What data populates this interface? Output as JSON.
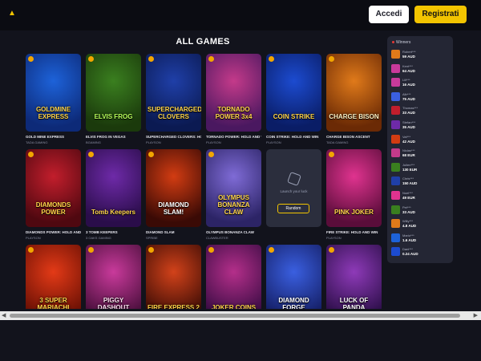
{
  "header": {
    "login_label": "Accedi",
    "register_label": "Registrati",
    "logo_glyph": "▲"
  },
  "section_title": "ALL GAMES",
  "games": [
    {
      "name": "GOLD MINE EXPRESS",
      "provider": "TADA GAMING",
      "logo": "GOLDMINE EXPRESS",
      "c1": "#1d62d9",
      "c2": "#0d2a78",
      "tc": "#ffd54a"
    },
    {
      "name": "ELVIS FROG IN VEGAS",
      "provider": "BGAMING",
      "logo": "ELVIS FROG",
      "c1": "#3a7f1f",
      "c2": "#1b3a0c",
      "tc": "#b7ff5a"
    },
    {
      "name": "SUPERCHARGED CLOVERS: HOLD AND WIN",
      "provider": "PLAYSON",
      "logo": "SUPERCHARGED CLOVERS",
      "c1": "#1f3fa8",
      "c2": "#0b1a52",
      "tc": "#ffd54a"
    },
    {
      "name": "TORNADO POWER: HOLD AND WIN",
      "provider": "PLAYSON",
      "logo": "TORNADO POWER 3x4",
      "c1": "#c43a8a",
      "c2": "#4a1860",
      "tc": "#ffd54a"
    },
    {
      "name": "COIN STRIKE: HOLD AND WIN",
      "provider": "PLAYSON",
      "logo": "COIN STRIKE",
      "c1": "#1c4bd0",
      "c2": "#0a1d66",
      "tc": "#ffd54a"
    },
    {
      "name": "CHARGE BISON ASCENT",
      "provider": "TADA GAMING",
      "logo": "CHARGE BISON",
      "c1": "#e07a1a",
      "c2": "#6b2a05",
      "tc": "#fff1c2"
    },
    {
      "name": "DIAMONDS POWER: HOLD AND WIN",
      "provider": "PLAYSON",
      "logo": "DIAMONDS POWER",
      "c1": "#c21e2c",
      "c2": "#4f0810",
      "tc": "#ffd54a"
    },
    {
      "name": "3 TOMB KEEPERS",
      "provider": "3 OAKS GAMING",
      "logo": "Tomb Keepers",
      "c1": "#6e2aa8",
      "c2": "#2a0d4a",
      "tc": "#ffd54a"
    },
    {
      "name": "DIAMOND SLAM",
      "provider": "SPRIBE",
      "logo": "DIAMOND SLAM!",
      "c1": "#d23c12",
      "c2": "#3a0a05",
      "tc": "#ffffff"
    },
    {
      "name": "OLYMPUS BONANZA CLAW",
      "provider": "CLAWBUSTER",
      "logo": "OLYMPUS BONANZA CLAW",
      "c1": "#7f6bd6",
      "c2": "#2c2466",
      "tc": "#ffd54a"
    },
    {
      "name": "FIRE STRIKE: HOLD AND WIN",
      "provider": "PLAYSON",
      "logo": "PINK JOKER",
      "c1": "#e0338f",
      "c2": "#5a0d3a",
      "tc": "#ffd54a"
    },
    {
      "name": "3 SUPER MARIACHI",
      "provider": "",
      "logo": "3 SUPER MARIACHI",
      "c1": "#e33a17",
      "c2": "#6a1004",
      "tc": "#ffd54a"
    },
    {
      "name": "PIGGY DASHOUT",
      "provider": "",
      "logo": "PIGGY DASHOUT",
      "c1": "#c93a9b",
      "c2": "#4a0f3c",
      "tc": "#ffe0f2"
    },
    {
      "name": "FIRE EXPRESS 2",
      "provider": "",
      "logo": "FIRE EXPRESS 2",
      "c1": "#d2421a",
      "c2": "#3c0c05",
      "tc": "#ffd54a"
    },
    {
      "name": "JOKER COINS",
      "provider": "",
      "logo": "JOKER COINS",
      "c1": "#b42f8a",
      "c2": "#3a0c44",
      "tc": "#ffd54a"
    },
    {
      "name": "DIAMOND FORGE",
      "provider": "",
      "logo": "DIAMOND FORGE",
      "c1": "#3a5fe0",
      "c2": "#151f66",
      "tc": "#ffffff"
    },
    {
      "name": "LUCK OF PANDA",
      "provider": "",
      "logo": "LUCK OF PANDA",
      "c1": "#8e3ab8",
      "c2": "#2d0f4a",
      "tc": "#ffffff"
    }
  ],
  "placeholder": {
    "text": "Launch your luck",
    "button": "Random"
  },
  "winners": {
    "title": "Winners",
    "list": [
      {
        "user": "Robert***",
        "amount": "59 AUD",
        "color": "#e07a1a"
      },
      {
        "user": "Kent***",
        "amount": "64 AUD",
        "color": "#c93a9b"
      },
      {
        "user": "Lili***",
        "amount": "16 AUD",
        "color": "#c93a9b"
      },
      {
        "user": "Alb***",
        "amount": "75 AUD",
        "color": "#3a5fe0"
      },
      {
        "user": "Thomas***",
        "amount": "33 AUD",
        "color": "#c21e2c"
      },
      {
        "user": "Stefan***",
        "amount": "35 AUD",
        "color": "#6e2aa8"
      },
      {
        "user": "Val***",
        "amount": "42 AUD",
        "color": "#d23c12"
      },
      {
        "user": "Niclas***",
        "amount": "68 EUR",
        "color": "#c43a8a"
      },
      {
        "user": "Julien***",
        "amount": "130 EUR",
        "color": "#3a7f1f"
      },
      {
        "user": "Chris***",
        "amount": "150 AUD",
        "color": "#1f3fa8"
      },
      {
        "user": "Noel***",
        "amount": "49 EUR",
        "color": "#e0338f"
      },
      {
        "user": "Pet***",
        "amount": "33 AUD",
        "color": "#3a7f1f"
      },
      {
        "user": "Willy***",
        "amount": "4.8 AUD",
        "color": "#e07a1a"
      },
      {
        "user": "Mario***",
        "amount": "1.6 AUD",
        "color": "#1d62d9"
      },
      {
        "user": "Dani***",
        "amount": "0.24 AUD",
        "color": "#1c4bd0"
      }
    ]
  },
  "scrollbar": {
    "left": "◀",
    "right": "▶"
  }
}
